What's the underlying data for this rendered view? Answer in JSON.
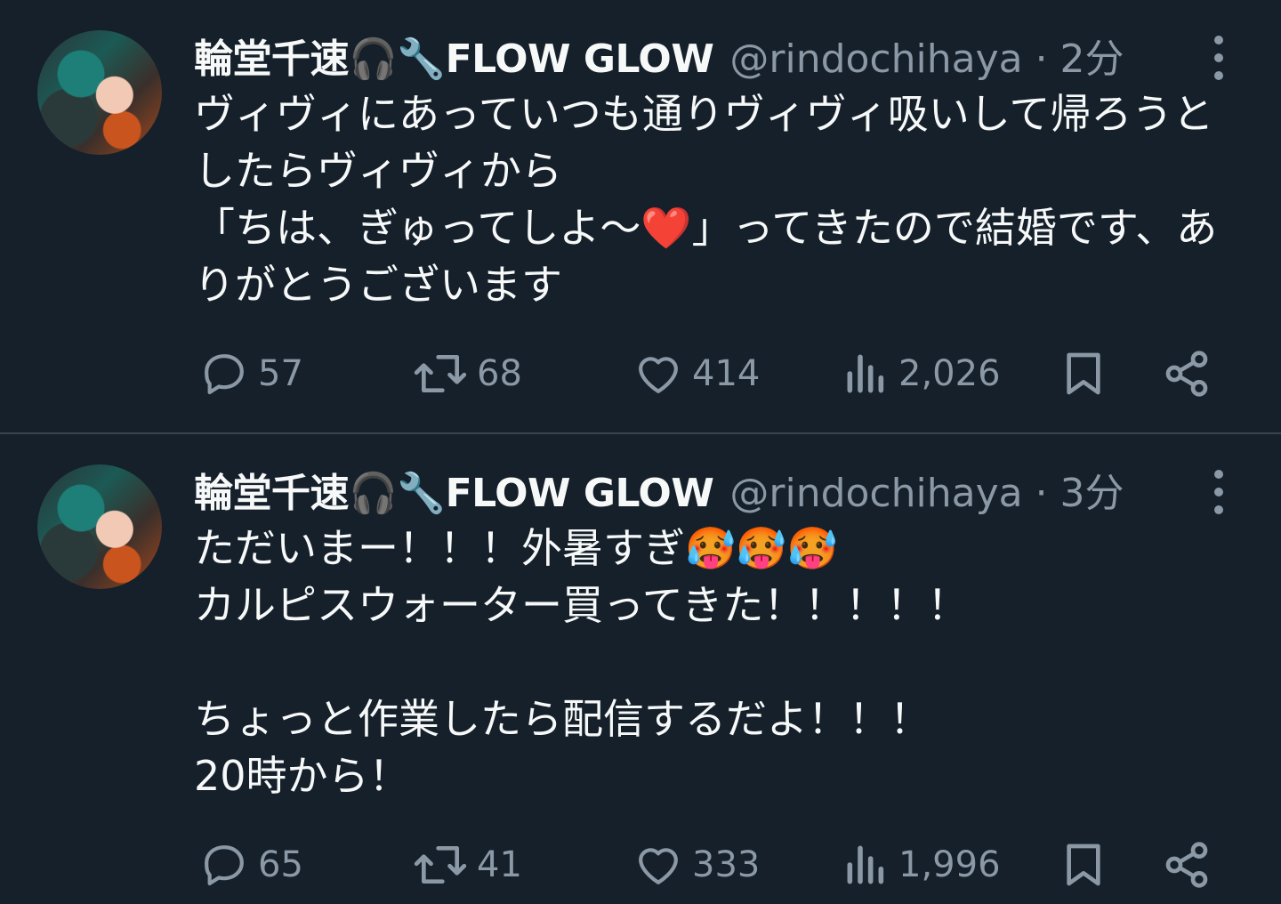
{
  "tweets": [
    {
      "name": "輪堂千速🎧🔧FLOW GLOW",
      "handle": "@rindochihaya · 2分",
      "text": "ヴィヴィにあっていつも通りヴィヴィ吸いして帰ろうとしたらヴィヴィから\n「ちは、ぎゅってしよ～❤️」ってきたので結婚です、ありがとうございます",
      "replies": "57",
      "retweets": "68",
      "likes": "414",
      "views": "2,026"
    },
    {
      "name": "輪堂千速🎧🔧FLOW GLOW",
      "handle": "@rindochihaya · 3分",
      "text": "ただいまー！！！外暑すぎ🥵🥵🥵\nカルピスウォーター買ってきた！！！！！\n\nちょっと作業したら配信するだよ！！！\n20時から！",
      "replies": "65",
      "retweets": "41",
      "likes": "333",
      "views": "1,996"
    }
  ],
  "icons": {
    "reply": "reply-icon",
    "retweet": "retweet-icon",
    "like": "like-icon",
    "views": "views-icon",
    "bookmark": "bookmark-icon",
    "share": "share-icon",
    "more": "more-icon"
  },
  "colors": {
    "background": "#15202b",
    "text": "#f7f9f9",
    "secondary": "#8b98a5",
    "divider": "#38444d"
  }
}
